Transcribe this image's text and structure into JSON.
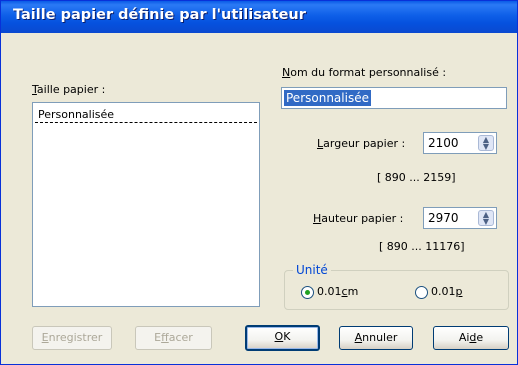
{
  "window": {
    "title": "Taille papier définie par l'utilisateur"
  },
  "paper_size": {
    "label_mnemonic": "T",
    "label_rest": "aille papier :",
    "items": [
      "Personnalisée"
    ]
  },
  "custom_name": {
    "label_mnemonic": "N",
    "label_rest": "om du format personnalisé :",
    "value": "Personnalisée"
  },
  "width": {
    "label_mnemonic": "L",
    "label_rest": "argeur papier :",
    "value": "2100",
    "range": "[ 890 ...  2159]"
  },
  "height": {
    "label_mnemonic": "H",
    "label_rest": "auteur papier :",
    "value": "2970",
    "range": "[ 890 ... 11176]"
  },
  "unit": {
    "label": "Unité",
    "option_cm_prefix": "0.01",
    "option_cm_mnemonic": "c",
    "option_cm_suffix": "m",
    "option_p_prefix": "0.01",
    "option_p_mnemonic": "p",
    "selected": "0.01cm"
  },
  "buttons": {
    "save_mnemonic": "E",
    "save_rest": "nregistrer",
    "delete_pre": "E",
    "delete_mnemonic": "f",
    "delete_rest": "facer",
    "ok_mnemonic": "O",
    "ok_rest": "K",
    "cancel_mnemonic": "A",
    "cancel_rest": "nnuler",
    "help_pre": "Ai",
    "help_mnemonic": "d",
    "help_rest": "e"
  }
}
